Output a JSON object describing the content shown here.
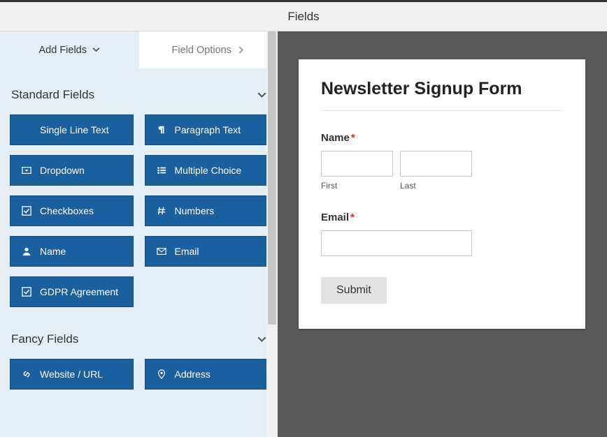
{
  "title": "Fields",
  "tabs": {
    "add_fields": "Add Fields",
    "field_options": "Field Options"
  },
  "sections": {
    "standard": "Standard Fields",
    "fancy": "Fancy Fields"
  },
  "standard_fields": {
    "single_line_text": "Single Line Text",
    "paragraph_text": "Paragraph Text",
    "dropdown": "Dropdown",
    "multiple_choice": "Multiple Choice",
    "checkboxes": "Checkboxes",
    "numbers": "Numbers",
    "name": "Name",
    "email": "Email",
    "gdpr_agreement": "GDPR Agreement"
  },
  "fancy_fields": {
    "website_url": "Website / URL",
    "address": "Address"
  },
  "form": {
    "title": "Newsletter Signup Form",
    "name_label": "Name",
    "first_label": "First",
    "last_label": "Last",
    "email_label": "Email",
    "submit_label": "Submit",
    "required_mark": "*"
  }
}
